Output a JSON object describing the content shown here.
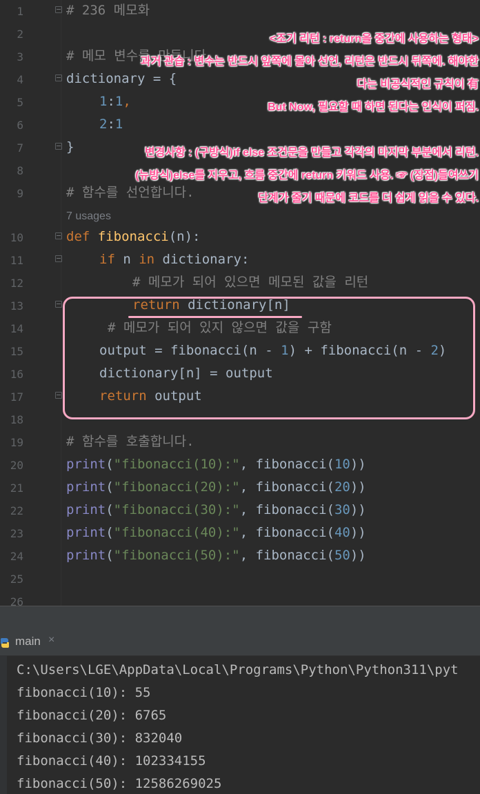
{
  "editor": {
    "lines": [
      {
        "num": "1",
        "text": "# 236 메모화"
      },
      {
        "num": "2"
      },
      {
        "num": "3",
        "text": "# 메모 변수를 만듭니다."
      },
      {
        "num": "4",
        "text": "dictionary = {"
      },
      {
        "num": "5",
        "a": "1",
        "b": ":",
        "c": "1",
        "d": ","
      },
      {
        "num": "6",
        "a": "2",
        "b": ":",
        "c": "1"
      },
      {
        "num": "7",
        "text": "}"
      },
      {
        "num": "8"
      },
      {
        "num": "9",
        "text": "# 함수를 선언합니다."
      },
      {
        "usages": "7 usages"
      },
      {
        "num": "10",
        "kw": "def",
        "fn": "fibonacci",
        "rest": "(n):"
      },
      {
        "num": "11",
        "kw": "if",
        "mid": " n ",
        "kw2": "in",
        "rest": " dictionary:"
      },
      {
        "num": "12",
        "text": "# 메모가 되어 있으면 메모된 값을 리턴"
      },
      {
        "num": "13",
        "kw": "return",
        "rest": " dictionary[n]"
      },
      {
        "num": "14",
        "text": "# 메모가 되어 있지 않으면 값을 구함"
      },
      {
        "num": "15",
        "a": "output = fibonacci(n - ",
        "n1": "1",
        "b": ") + fibonacci(n - ",
        "n2": "2",
        "c": ")"
      },
      {
        "num": "16",
        "text": "dictionary[n] = output"
      },
      {
        "num": "17",
        "kw": "return",
        "rest": " output"
      },
      {
        "num": "18"
      },
      {
        "num": "19",
        "text": "# 함수를 호출합니다."
      },
      {
        "num": "20",
        "fn": "print",
        "open": "(",
        "str": "\"fibonacci(10):\"",
        "sep": ", fibonacci(",
        "n": "10",
        "close": "))"
      },
      {
        "num": "21",
        "fn": "print",
        "open": "(",
        "str": "\"fibonacci(20):\"",
        "sep": ", fibonacci(",
        "n": "20",
        "close": "))"
      },
      {
        "num": "22",
        "fn": "print",
        "open": "(",
        "str": "\"fibonacci(30):\"",
        "sep": ", fibonacci(",
        "n": "30",
        "close": "))"
      },
      {
        "num": "23",
        "fn": "print",
        "open": "(",
        "str": "\"fibonacci(40):\"",
        "sep": ", fibonacci(",
        "n": "40",
        "close": "))"
      },
      {
        "num": "24",
        "fn": "print",
        "open": "(",
        "str": "\"fibonacci(50):\"",
        "sep": ", fibonacci(",
        "n": "50",
        "close": "))"
      },
      {
        "num": "25"
      },
      {
        "num": "26"
      }
    ]
  },
  "annotations": {
    "a1": "<조기 리턴 : return을 중간에 사용하는 형태>",
    "a2": "과거 관습 : 변수는 반드시 앞쪽에 몰아 선언, 리턴은 반드시 뒤쪽에. 해야한",
    "a3": "다는 비공식적인 규칙이 有",
    "a4": "But Now, 필요할 때 하면 된다는 인식이 퍼짐.",
    "a5": "변경사항 : (구방식)if else 조건문을 만들고 각각의 마지막 부분에서 리턴.",
    "a6": "(뉴방식)else를 지우고, 흐름 중간에 return 키워드 사용. ☞ (장점)들여쓰기",
    "a7": "단계가 줄기 때문에 코드를 더 쉽게 읽을 수 있다."
  },
  "run": {
    "tab_label": "main",
    "close_glyph": "×",
    "output": [
      "C:\\Users\\LGE\\AppData\\Local\\Programs\\Python\\Python311\\pyt",
      "fibonacci(10): 55",
      "fibonacci(20): 6765",
      "fibonacci(30): 832040",
      "fibonacci(40): 102334155",
      "fibonacci(50): 12586269025"
    ]
  },
  "colors": {
    "background": "#2b2b2b",
    "keyword": "#cc7832",
    "function": "#ffc66d",
    "number": "#6897bb",
    "string": "#6a8759",
    "comment": "#808080",
    "annotation": "#ff4f93",
    "highlight_box": "#f7a8c3"
  }
}
